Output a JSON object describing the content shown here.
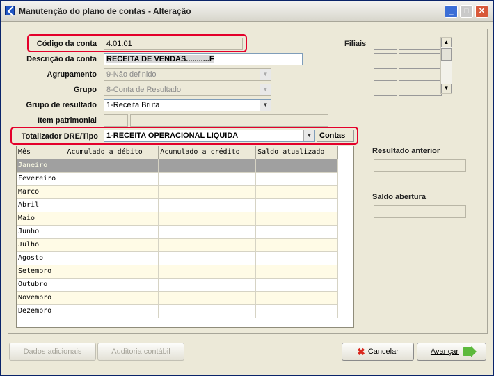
{
  "window": {
    "title": "Manutenção do plano de contas - Alteração"
  },
  "form": {
    "codigo_label": "Código da conta",
    "codigo_value": "4.01.01",
    "descricao_label": "Descrição da conta",
    "descricao_value": "RECEITA DE VENDAS...........F",
    "agrupamento_label": "Agrupamento",
    "agrupamento_value": "9-Não definido",
    "grupo_label": "Grupo",
    "grupo_value": "8-Conta de Resultado",
    "grupo_resultado_label": "Grupo de resultado",
    "grupo_resultado_value": "1-Receita Bruta",
    "item_patrimonial_label": "Item patrimonial",
    "totalizador_label": "Totalizador DRE/Tipo",
    "totalizador_value": "1-RECEITA OPERACIONAL LIQUIDA",
    "contas_label": "Contas"
  },
  "right": {
    "filiais_label": "Filiais",
    "resultado_anterior_label": "Resultado anterior",
    "saldo_abertura_label": "Saldo abertura"
  },
  "grid": {
    "columns": [
      "Mês",
      "Acumulado a débito",
      "Acumulado a crédito",
      "Saldo atualizado"
    ],
    "months": [
      "Janeiro",
      "Fevereiro",
      "Marco",
      "Abril",
      "Maio",
      "Junho",
      "Julho",
      "Agosto",
      "Setembro",
      "Outubro",
      "Novembro",
      "Dezembro"
    ]
  },
  "buttons": {
    "dados_adicionais": "Dados adicionais",
    "auditoria": "Auditoria contábil",
    "cancelar": "Cancelar",
    "avancar": "Avançar"
  },
  "colors": {
    "highlight": "#e4002b",
    "selected_row": "#a0a0a0"
  }
}
